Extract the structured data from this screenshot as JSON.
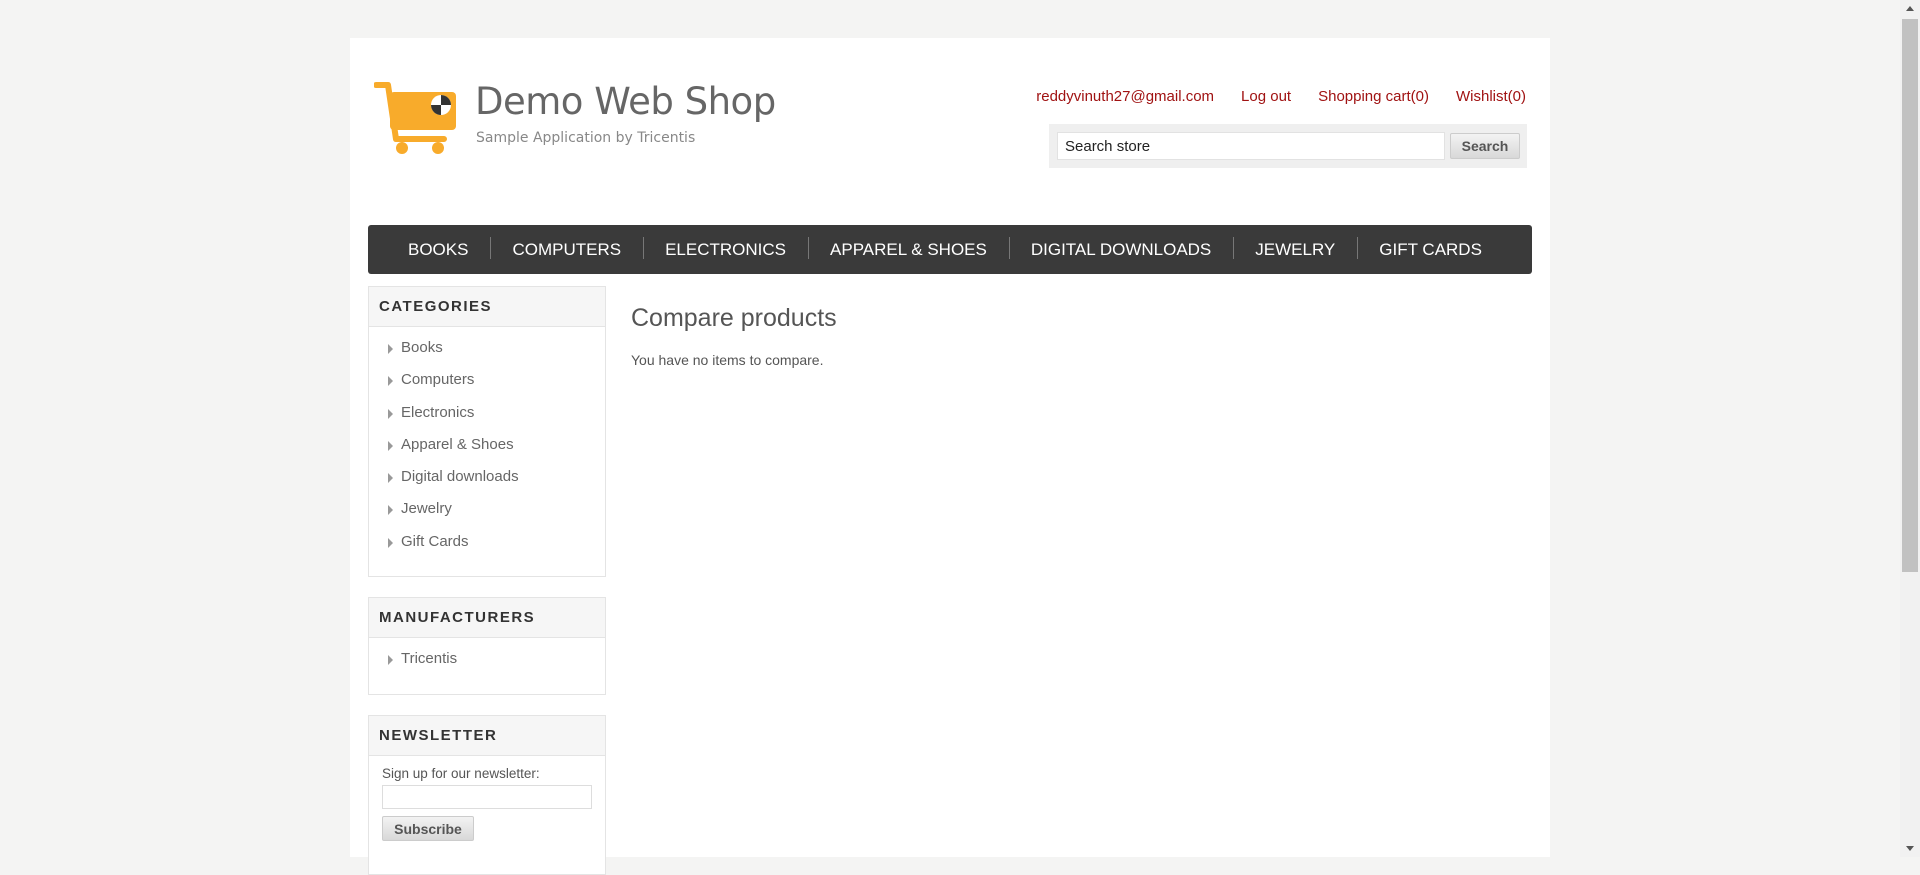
{
  "header": {
    "logo_title": "Demo Web Shop",
    "logo_subtitle": "Sample Application by Tricentis",
    "links": {
      "account": "reddyvinuth27@gmail.com",
      "logout": "Log out",
      "cart": "Shopping cart(0)",
      "wishlist": "Wishlist(0)"
    },
    "search": {
      "value": "Search store",
      "button": "Search"
    }
  },
  "top_menu": [
    "BOOKS",
    "COMPUTERS",
    "ELECTRONICS",
    "APPAREL & SHOES",
    "DIGITAL DOWNLOADS",
    "JEWELRY",
    "GIFT CARDS"
  ],
  "categories": {
    "title": "CATEGORIES",
    "items": [
      "Books",
      "Computers",
      "Electronics",
      "Apparel & Shoes",
      "Digital downloads",
      "Jewelry",
      "Gift Cards"
    ]
  },
  "manufacturers": {
    "title": "MANUFACTURERS",
    "items": [
      "Tricentis"
    ]
  },
  "newsletter": {
    "title": "NEWSLETTER",
    "label": "Sign up for our newsletter:",
    "button": "Subscribe"
  },
  "main": {
    "title": "Compare products",
    "message": "You have no items to compare."
  },
  "colors": {
    "link": "#a01212",
    "menu_bg": "#3a3a3a",
    "logo_orange": "#f8ab2b"
  }
}
